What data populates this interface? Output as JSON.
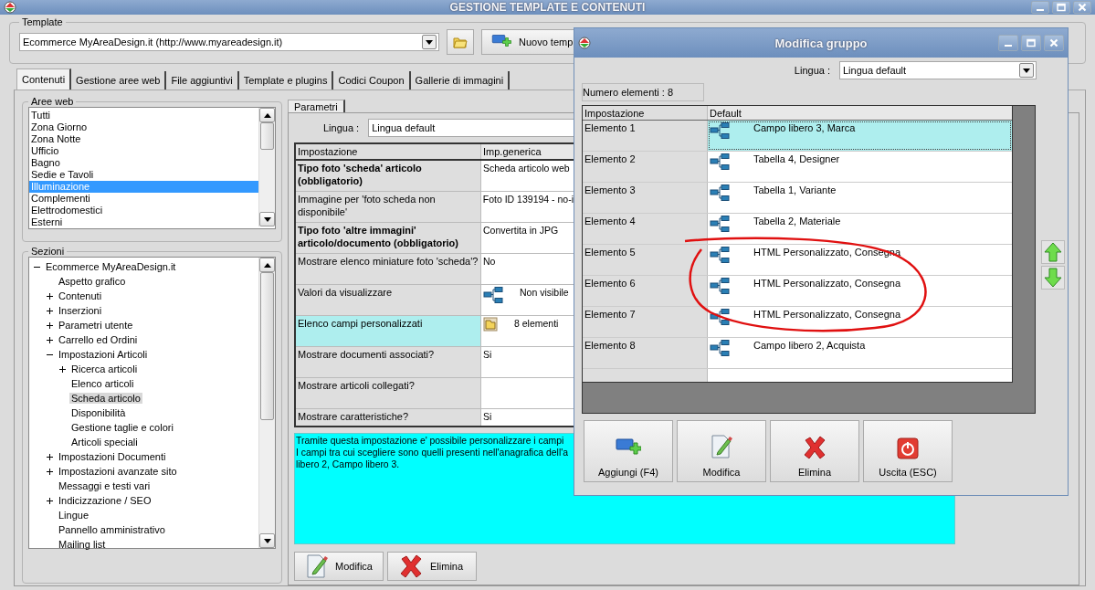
{
  "window": {
    "title": "GESTIONE TEMPLATE E CONTENUTI"
  },
  "template": {
    "legend": "Template",
    "value": "Ecommerce MyAreaDesign.it (http://www.myareadesign.it)",
    "new_button": "Nuovo temp"
  },
  "tabs": [
    {
      "label": "Contenuti",
      "selected": true
    },
    {
      "label": "Gestione aree web",
      "selected": false
    },
    {
      "label": "File aggiuntivi",
      "selected": false
    },
    {
      "label": "Template e plugins",
      "selected": false
    },
    {
      "label": "Codici Coupon",
      "selected": false
    },
    {
      "label": "Gallerie di immagini",
      "selected": false
    }
  ],
  "aree_web": {
    "legend": "Aree web",
    "items": [
      {
        "label": "Tutti",
        "selected": false
      },
      {
        "label": "Zona Giorno",
        "selected": false
      },
      {
        "label": "Zona Notte",
        "selected": false
      },
      {
        "label": "Ufficio",
        "selected": false
      },
      {
        "label": "Bagno",
        "selected": false
      },
      {
        "label": "Sedie e Tavoli",
        "selected": false
      },
      {
        "label": "Illuminazione",
        "selected": true
      },
      {
        "label": "Complementi",
        "selected": false
      },
      {
        "label": "Elettrodomestici",
        "selected": false
      },
      {
        "label": "Esterni",
        "selected": false
      }
    ]
  },
  "sezioni": {
    "legend": "Sezioni",
    "tree": [
      {
        "label": "Ecommerce MyAreaDesign.it",
        "expanded": true,
        "selected": false,
        "children": [
          {
            "label": "Aspetto grafico",
            "selected": false
          },
          {
            "label": "Contenuti",
            "expanded": false,
            "selected": false
          },
          {
            "label": "Inserzioni",
            "expanded": false,
            "selected": false
          },
          {
            "label": "Parametri utente",
            "expanded": false,
            "selected": false
          },
          {
            "label": "Carrello ed Ordini",
            "expanded": false,
            "selected": false
          },
          {
            "label": "Impostazioni Articoli",
            "expanded": true,
            "selected": false,
            "children": [
              {
                "label": "Ricerca articoli",
                "expanded": false,
                "selected": false
              },
              {
                "label": "Elenco articoli",
                "selected": false
              },
              {
                "label": "Scheda articolo",
                "selected": true
              },
              {
                "label": "Disponibilità",
                "selected": false
              },
              {
                "label": "Gestione taglie e colori",
                "selected": false
              },
              {
                "label": "Articoli speciali",
                "selected": false
              }
            ]
          },
          {
            "label": "Impostazioni Documenti",
            "expanded": false,
            "selected": false
          },
          {
            "label": "Impostazioni avanzate sito",
            "expanded": false,
            "selected": false
          },
          {
            "label": "Messaggi e testi vari",
            "selected": false
          },
          {
            "label": "Indicizzazione / SEO",
            "expanded": false,
            "selected": false
          },
          {
            "label": "Lingue",
            "selected": false
          },
          {
            "label": "Pannello amministrativo",
            "selected": false
          },
          {
            "label": "Mailing list",
            "selected": false
          }
        ]
      }
    ]
  },
  "parametri": {
    "tabs": [
      {
        "label": "Parametri",
        "selected": true
      }
    ],
    "lingua_label": "Lingua :",
    "lingua_value": "Lingua default",
    "columns": [
      "Impostazione",
      "Imp.generica"
    ],
    "rows": [
      {
        "setting": "Tipo foto 'scheda' articolo (obbligatorio)",
        "bold": true,
        "selected": false,
        "kind": "text",
        "value": "Scheda articolo web"
      },
      {
        "setting": "Immagine per 'foto scheda non disponibile'",
        "bold": false,
        "selected": false,
        "kind": "text",
        "value": "Foto ID 139194 - no-i"
      },
      {
        "setting": "Tipo foto 'altre immagini' articolo/documento (obbligatorio)",
        "bold": true,
        "selected": false,
        "kind": "text",
        "value": "Convertita in JPG"
      },
      {
        "setting": "Mostrare elenco miniature foto 'scheda'?",
        "bold": false,
        "selected": false,
        "kind": "text",
        "value": "No"
      },
      {
        "setting": "Valori da visualizzare",
        "bold": false,
        "selected": false,
        "kind": "tree",
        "value": "Non visibile"
      },
      {
        "setting": "Elenco campi personalizzati",
        "bold": false,
        "selected": true,
        "kind": "folder",
        "value": "8 elementi"
      },
      {
        "setting": "Mostrare documenti associati?",
        "bold": false,
        "selected": false,
        "kind": "text",
        "value": "Si"
      },
      {
        "setting": "Mostrare articoli collegati?",
        "bold": false,
        "selected": false,
        "kind": "text"
      },
      {
        "setting": "Mostrare caratteristiche?",
        "bold": false,
        "selected": false,
        "kind": "text",
        "value": "Si"
      }
    ],
    "description": [
      "Tramite questa impostazione e' possibile personalizzare i campi",
      "I campi tra cui scegliere sono quelli presenti nell'anagrafica dell'a",
      "libero 2, Campo libero 3."
    ],
    "buttons": [
      {
        "label": "Modifica",
        "kind": "edit"
      },
      {
        "label": "Elimina",
        "kind": "delete"
      }
    ]
  },
  "dialog": {
    "title": "Modifica gruppo",
    "lingua_label": "Lingua :",
    "lingua_value": "Lingua default",
    "count": "Numero elementi : 8",
    "columns": [
      "Impostazione",
      "Default"
    ],
    "rows": [
      {
        "label": "Elemento 1",
        "value": "Campo libero 3, Marca",
        "selected": true
      },
      {
        "label": "Elemento 2",
        "value": "Tabella 4, Designer",
        "selected": false
      },
      {
        "label": "Elemento 3",
        "value": "Tabella 1, Variante",
        "selected": false
      },
      {
        "label": "Elemento 4",
        "value": "Tabella 2, Materiale",
        "selected": false
      },
      {
        "label": "Elemento 5",
        "value": "HTML Personalizzato, Consegna",
        "selected": false
      },
      {
        "label": "Elemento 6",
        "value": "HTML Personalizzato, Consegna",
        "selected": false
      },
      {
        "label": "Elemento 7",
        "value": "HTML Personalizzato, Consegna",
        "selected": false
      },
      {
        "label": "Elemento 8",
        "value": "Campo libero 2, Acquista",
        "selected": false
      }
    ],
    "buttons": [
      {
        "label": "Aggiungi (F4)",
        "kind": "add"
      },
      {
        "label": "Modifica",
        "kind": "edit"
      },
      {
        "label": "Elimina",
        "kind": "delete"
      },
      {
        "label": "Uscita (ESC)",
        "kind": "exit"
      }
    ]
  },
  "annotation": {
    "kind": "ellipse"
  }
}
